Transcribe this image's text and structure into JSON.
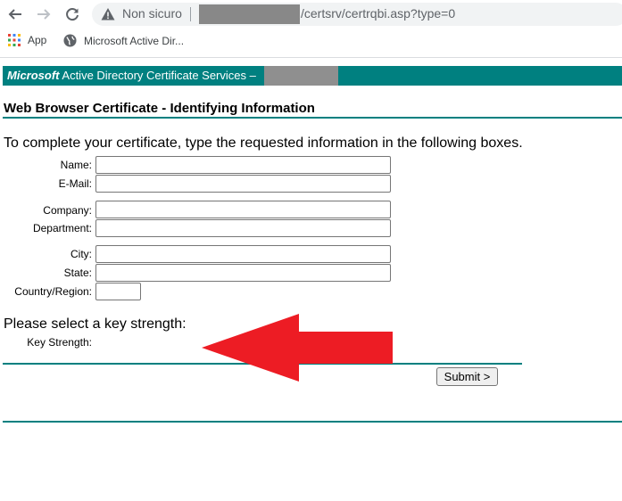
{
  "browser": {
    "security_label": "Non sicuro",
    "url_path": "/certsrv/certrqbi.asp?type=0",
    "bookmarks": [
      {
        "label": "App",
        "icon": "apps-grid-icon"
      },
      {
        "label": "Microsoft Active Dir...",
        "icon": "globe-icon"
      }
    ]
  },
  "banner": {
    "brand": "Microsoft",
    "title": " Active Directory Certificate Services",
    "dash": " –"
  },
  "page": {
    "title": "Web Browser Certificate - Identifying Information",
    "intro": "To complete your certificate, type the requested information in the following boxes."
  },
  "form": {
    "name_label": "Name:",
    "email_label": "E-Mail:",
    "company_label": "Company:",
    "department_label": "Department:",
    "city_label": "City:",
    "state_label": "State:",
    "country_label": "Country/Region:",
    "name_value": "",
    "email_value": "",
    "company_value": "",
    "department_value": "",
    "city_value": "",
    "state_value": "",
    "country_value": ""
  },
  "key": {
    "heading": "Please select a key strength:",
    "label": "Key Strength:"
  },
  "submit_label": "Submit >",
  "colors": {
    "banner": "#008080",
    "annotation_arrow": "#ed1c24"
  }
}
